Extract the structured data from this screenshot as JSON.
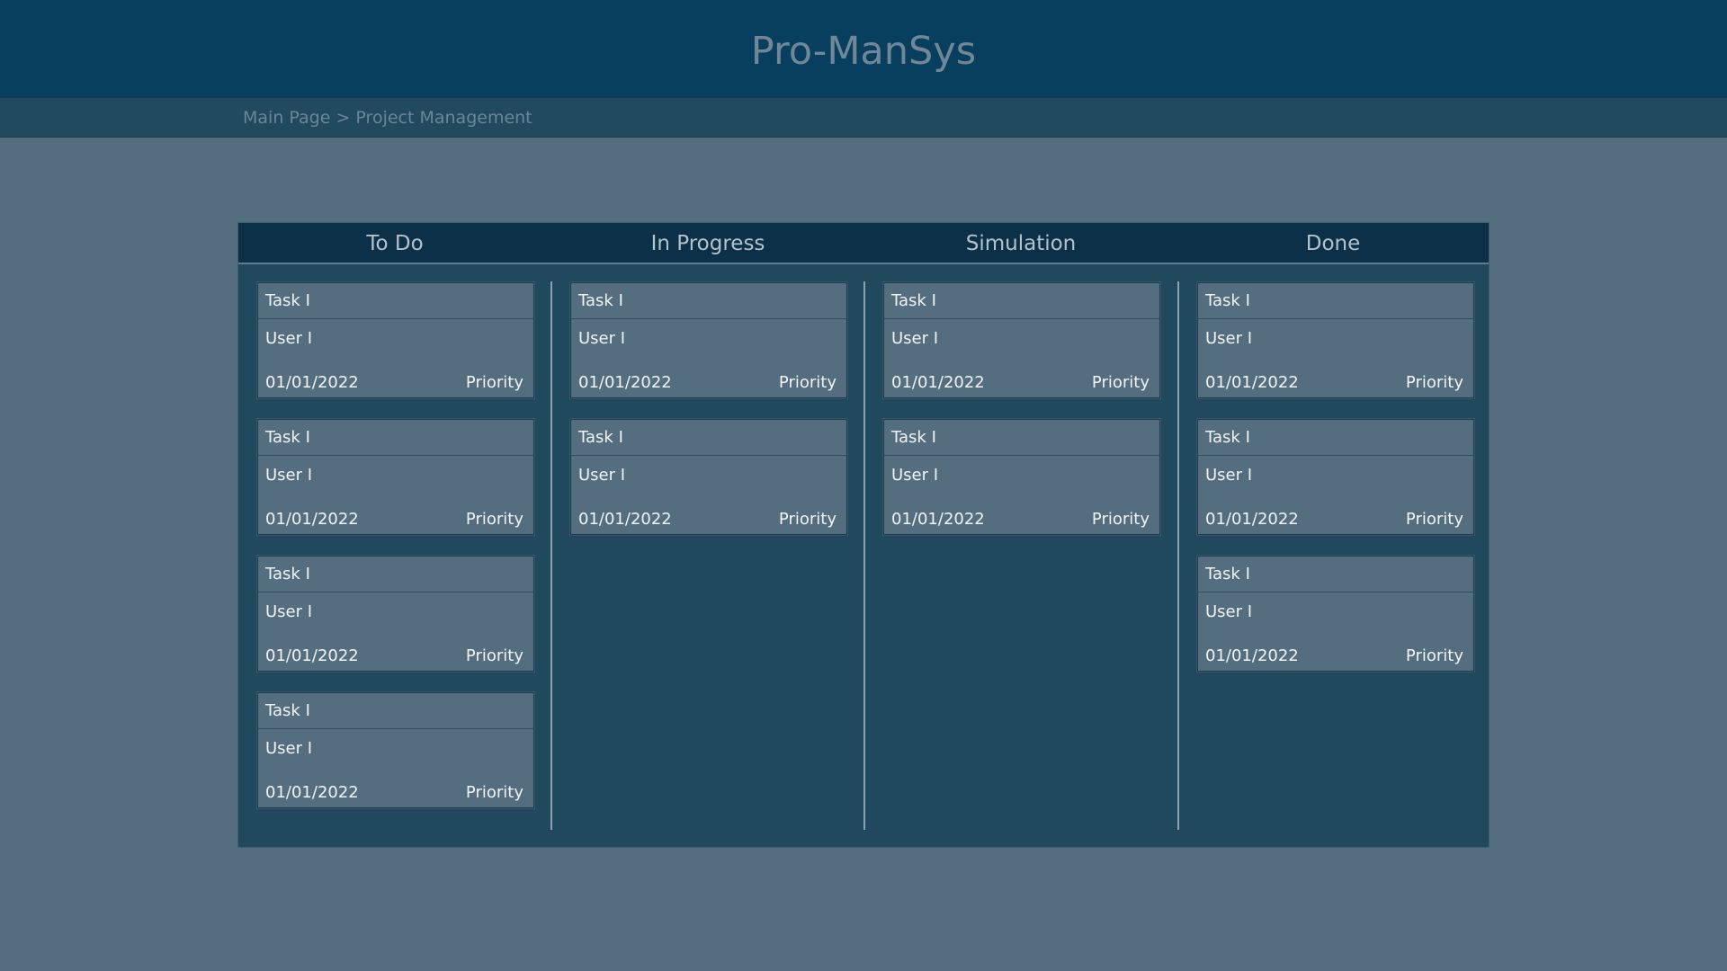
{
  "app": {
    "title": "Pro-ManSys"
  },
  "breadcrumb": {
    "home": "Main Page",
    "separator": ">",
    "current": "Project Management"
  },
  "columns": [
    {
      "title": "To Do",
      "cards": [
        {
          "task": "Task I",
          "user": "User I",
          "date": "01/01/2022",
          "priority": "Priority"
        },
        {
          "task": "Task I",
          "user": "User I",
          "date": "01/01/2022",
          "priority": "Priority"
        },
        {
          "task": "Task I",
          "user": "User I",
          "date": "01/01/2022",
          "priority": "Priority"
        },
        {
          "task": "Task I",
          "user": "User I",
          "date": "01/01/2022",
          "priority": "Priority"
        }
      ]
    },
    {
      "title": "In Progress",
      "cards": [
        {
          "task": "Task I",
          "user": "User I",
          "date": "01/01/2022",
          "priority": "Priority"
        },
        {
          "task": "Task I",
          "user": "User I",
          "date": "01/01/2022",
          "priority": "Priority"
        }
      ]
    },
    {
      "title": "Simulation",
      "cards": [
        {
          "task": "Task I",
          "user": "User I",
          "date": "01/01/2022",
          "priority": "Priority"
        },
        {
          "task": "Task I",
          "user": "User I",
          "date": "01/01/2022",
          "priority": "Priority"
        }
      ]
    },
    {
      "title": "Done",
      "cards": [
        {
          "task": "Task I",
          "user": "User I",
          "date": "01/01/2022",
          "priority": "Priority"
        },
        {
          "task": "Task I",
          "user": "User I",
          "date": "01/01/2022",
          "priority": "Priority"
        },
        {
          "task": "Task I",
          "user": "User I",
          "date": "01/01/2022",
          "priority": "Priority"
        }
      ]
    }
  ],
  "colors": {
    "header_bg": "#093f5e",
    "breadcrumb_bg": "#214a5f",
    "page_bg": "#546e80",
    "board_bg": "#21495d",
    "board_header_bg": "#0c3048",
    "card_bg": "#546e80"
  }
}
